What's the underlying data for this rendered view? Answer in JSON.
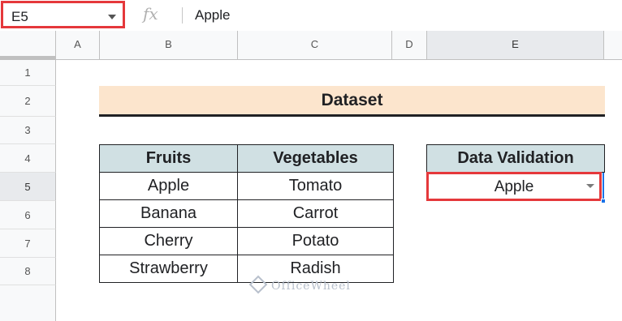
{
  "formula_bar": {
    "name_box": "E5",
    "fx_label": "fx",
    "content": "Apple"
  },
  "columns": [
    "A",
    "B",
    "C",
    "D",
    "E"
  ],
  "rows": [
    "1",
    "2",
    "3",
    "4",
    "5",
    "6",
    "7",
    "8"
  ],
  "active_cell": {
    "column": "E",
    "row": "5"
  },
  "dataset_title": "Dataset",
  "table": {
    "headers": [
      "Fruits",
      "Vegetables"
    ],
    "rows": [
      [
        "Apple",
        "Tomato"
      ],
      [
        "Banana",
        "Carrot"
      ],
      [
        "Cherry",
        "Potato"
      ],
      [
        "Strawberry",
        "Radish"
      ]
    ]
  },
  "data_validation": {
    "header": "Data Validation",
    "value": "Apple"
  },
  "watermark": "OfficeWheel",
  "colors": {
    "highlight_border": "#e5383b",
    "title_fill": "#fce5cd",
    "header_fill": "#d0e0e3",
    "selection": "#1a73e8"
  }
}
